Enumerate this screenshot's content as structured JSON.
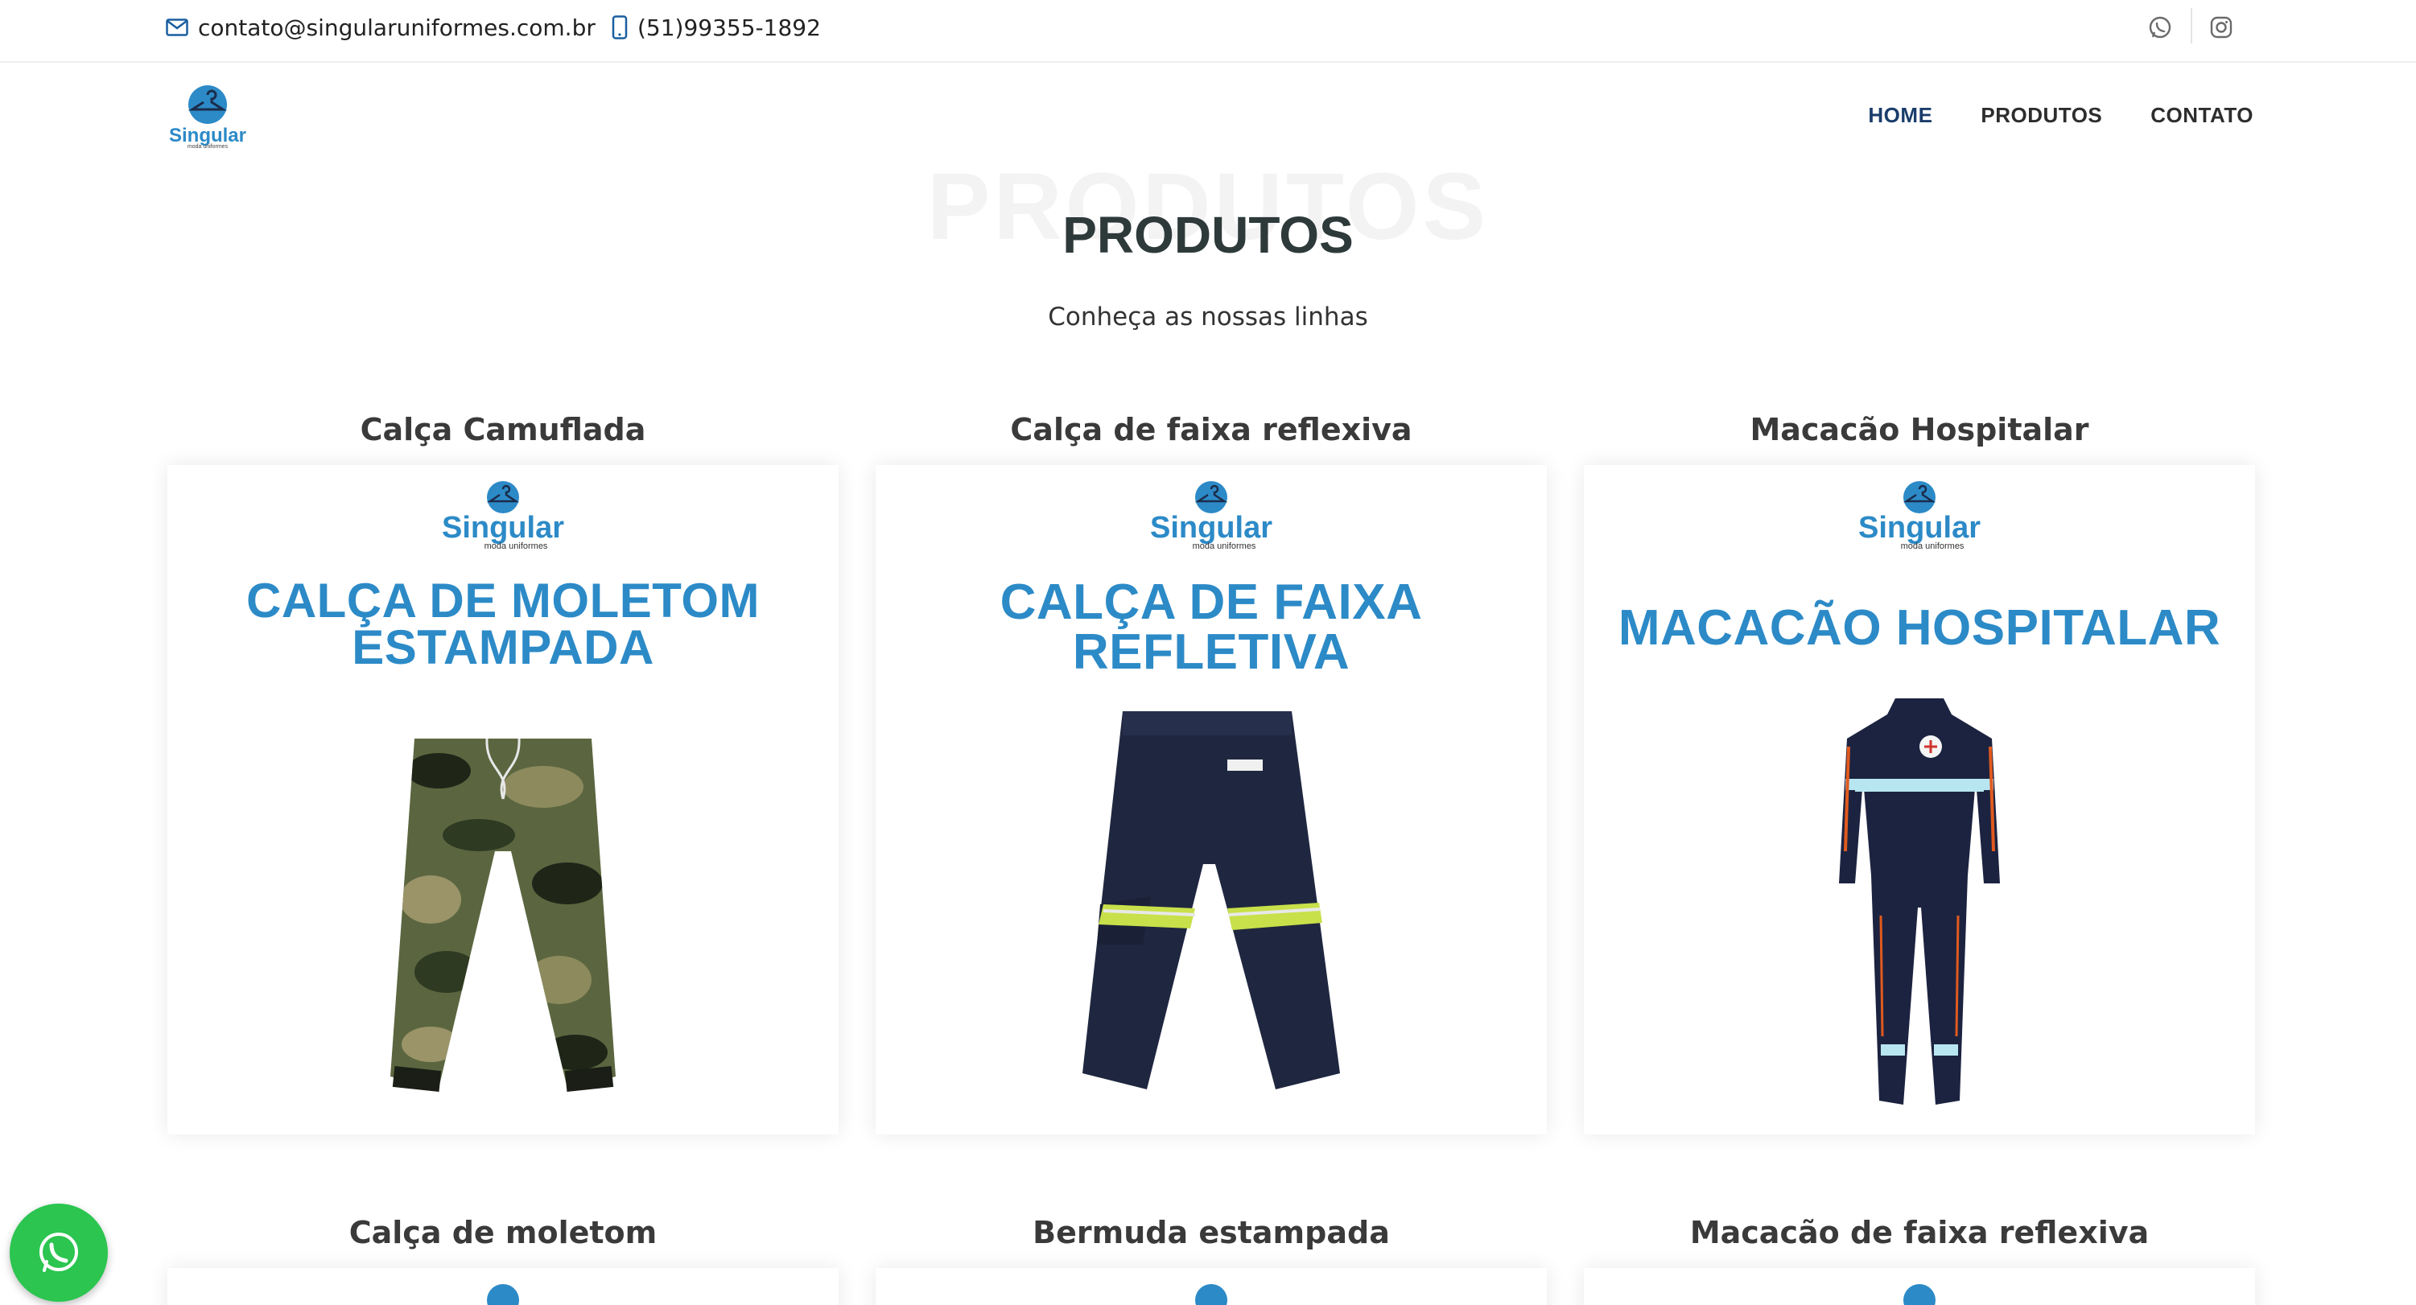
{
  "topbar": {
    "email": "contato@singularuniformes.com.br",
    "phone": "(51)99355-1892",
    "social": [
      {
        "icon": "whatsapp-icon"
      },
      {
        "icon": "instagram-icon"
      }
    ]
  },
  "header": {
    "logo_brand": "Singular",
    "logo_tagline": "moda uniformes",
    "nav": [
      {
        "label": "HOME",
        "active": true
      },
      {
        "label": "PRODUTOS",
        "active": false
      },
      {
        "label": "CONTATO",
        "active": false
      }
    ]
  },
  "section": {
    "bg_title": "PRODUTOS",
    "title": "PRODUTOS",
    "subtitle": "Conheça as nossas linhas"
  },
  "products": [
    {
      "name": "Calça Camuflada",
      "headline_1": "CALÇA DE MOLETOM",
      "headline_2": "ESTAMPADA"
    },
    {
      "name": "Calça de faixa reflexiva",
      "headline_1": "CALÇA DE FAIXA",
      "headline_2": "REFLETIVA"
    },
    {
      "name": "Macacão Hospitalar",
      "headline_1": "MACACÃO HOSPITALAR",
      "headline_2": ""
    },
    {
      "name": "Calça de moletom"
    },
    {
      "name": "Bermuda estampada"
    },
    {
      "name": "Macacão de faixa reflexiva"
    }
  ],
  "colors": {
    "brand_blue": "#2c8ac7",
    "nav_active": "#1a3d6b",
    "whatsapp_green": "#2bc550"
  }
}
